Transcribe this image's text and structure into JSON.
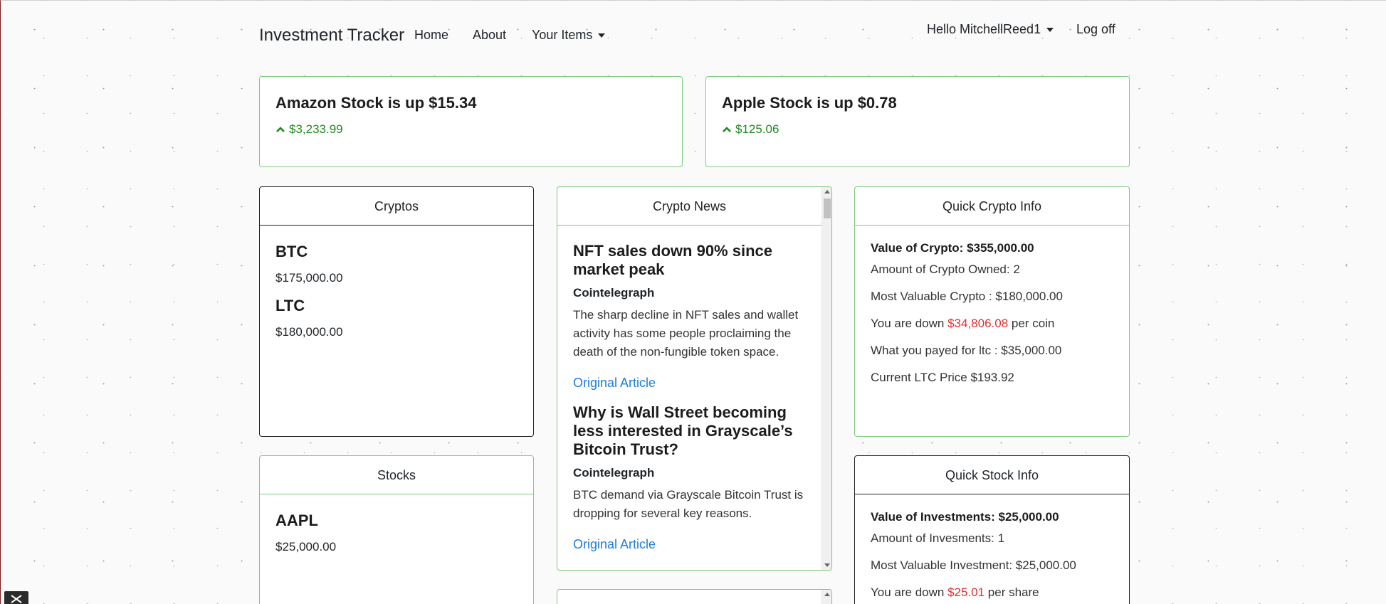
{
  "navbar": {
    "brand": "Investment Tracker",
    "home": "Home",
    "about": "About",
    "your_items": "Your Items",
    "greeting": "Hello MitchellReed1",
    "logoff": "Log off"
  },
  "tickers": [
    {
      "title": "Amazon Stock is up $15.34",
      "price": "$3,233.99",
      "direction": "up"
    },
    {
      "title": "Apple Stock is up $0.78",
      "price": "$125.06",
      "direction": "up"
    }
  ],
  "cryptos": {
    "header": "Cryptos",
    "items": [
      {
        "name": "BTC",
        "value": "$175,000.00"
      },
      {
        "name": "LTC",
        "value": "$180,000.00"
      }
    ]
  },
  "stocks": {
    "header": "Stocks",
    "items": [
      {
        "name": "AAPL",
        "value": "$25,000.00"
      }
    ]
  },
  "news": {
    "header": "Crypto News",
    "articles": [
      {
        "title": "NFT sales down 90% since market peak",
        "source": "Cointelegraph",
        "description": "The sharp decline in NFT sales and wallet activity has some people proclaiming the death of the non-fungible token space.",
        "link": "Original Article"
      },
      {
        "title": "Why is Wall Street becoming less interested in Grayscale’s Bitcoin Trust?",
        "source": "Cointelegraph",
        "description": "BTC demand via Grayscale Bitcoin Trust is dropping for several key reasons.",
        "link": "Original Article"
      }
    ]
  },
  "quick_crypto": {
    "header": "Quick Crypto Info",
    "value_label": "Value of Crypto: $355,000.00",
    "amount_owned": "Amount of Crypto Owned: 2",
    "most_valuable": "Most Valuable Crypto : $180,000.00",
    "down_prefix": "You are down ",
    "down_amount": "$34,806.08",
    "down_suffix": " per coin",
    "paid": "What you payed for ltc : $35,000.00",
    "current_price": "Current LTC Price $193.92"
  },
  "quick_stock": {
    "header": "Quick Stock Info",
    "value_label": "Value of Investments: $25,000.00",
    "amount": "Amount of Invesments: 1",
    "most_valuable": "Most Valuable Investment: $25,000.00",
    "down_prefix": "You are down ",
    "down_amount": "$25.01",
    "down_suffix": " per share"
  },
  "colors": {
    "positive": "#1e8a1e",
    "negative": "#e03030",
    "link": "#1d7ee0",
    "card_border_green": "#7ccc7c"
  },
  "icons": {
    "ticker_direction": "chevron-up-icon",
    "dropdown": "caret-down-icon",
    "corner": "extension-badge-icon"
  }
}
